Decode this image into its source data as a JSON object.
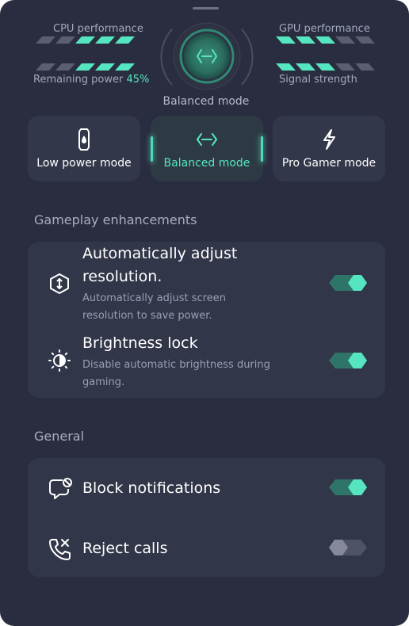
{
  "stats": {
    "cpu_label": "CPU performance",
    "gpu_label": "GPU performance",
    "remaining_label": "Remaining power",
    "remaining_value": "45%",
    "signal_label": "Signal strength",
    "bar_segments": 5,
    "cpu_level": 3,
    "gpu_level": 3,
    "remaining_level": 3,
    "signal_level": 3
  },
  "current_mode": "Balanced mode",
  "modes": [
    {
      "label": "Low power mode",
      "icon": "battery-drop-icon",
      "active": false
    },
    {
      "label": "Balanced mode",
      "icon": "balance-arrows-icon",
      "active": true
    },
    {
      "label": "Pro Gamer mode",
      "icon": "lightning-icon",
      "active": false
    }
  ],
  "gameplay": {
    "title": "Gameplay enhancements",
    "items": [
      {
        "title_line1": "Automatically adjust",
        "title_line2": "resolution.",
        "desc_line1": "Automatically adjust screen",
        "desc_line2": "resolution to save power.",
        "icon": "resolution-icon",
        "enabled": true
      },
      {
        "title_line1": "Brightness lock",
        "desc_line1": "Disable automatic brightness during",
        "desc_line2": "gaming.",
        "icon": "brightness-icon",
        "enabled": true
      }
    ]
  },
  "general": {
    "title": "General",
    "items": [
      {
        "title": "Block notifications",
        "icon": "block-notification-icon",
        "enabled": true
      },
      {
        "title": "Reject calls",
        "icon": "reject-call-icon",
        "enabled": false
      }
    ]
  },
  "colors": {
    "background": "#2a2d3f",
    "card": "#323649",
    "accent": "#55e6c1",
    "accent_dim": "#2f7567",
    "bar_empty": "#5a5e70",
    "toggle_off": "#4f5366"
  }
}
